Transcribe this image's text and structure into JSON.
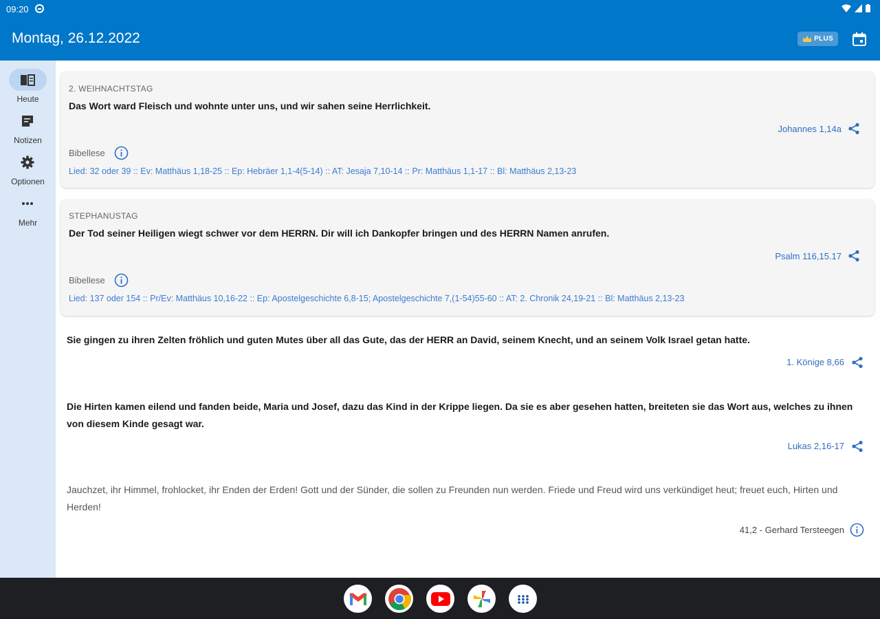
{
  "status": {
    "time": "09:20"
  },
  "appbar": {
    "title": "Montag, 26.12.2022",
    "plus_label": "PLUS"
  },
  "sidebar": {
    "items": [
      {
        "label": "Heute",
        "icon": "book-icon",
        "active": true
      },
      {
        "label": "Notizen",
        "icon": "note-icon",
        "active": false
      },
      {
        "label": "Optionen",
        "icon": "gear-icon",
        "active": false
      },
      {
        "label": "Mehr",
        "icon": "more-icon",
        "active": false
      }
    ]
  },
  "cards": [
    {
      "kicker": "2. WEIHNACHTSTAG",
      "verse": "Das Wort ward Fleisch und wohnte unter uns, und wir sahen seine Herrlichkeit.",
      "reference": "Johannes 1,14a",
      "bibellese_label": "Bibellese",
      "readings": "Lied: 32 oder 39 :: Ev: Matthäus 1,18-25 :: Ep: Hebräer 1,1-4(5-14) :: AT: Jesaja 7,10-14 :: Pr: Matthäus 1,1-17 :: Bl: Matthäus 2,13-23"
    },
    {
      "kicker": "STEPHANUSTAG",
      "verse": "Der Tod seiner Heiligen wiegt schwer vor dem HERRN. Dir will ich Dankopfer bringen und des HERRN Namen anrufen.",
      "reference": "Psalm 116,15.17",
      "bibellese_label": "Bibellese",
      "readings": "Lied: 137 oder 154 :: Pr/Ev: Matthäus 10,16-22 :: Ep: Apostelgeschichte 6,8-15; Apostelgeschichte 7,(1-54)55-60 :: AT: 2. Chronik 24,19-21 :: Bl: Matthäus 2,13-23"
    }
  ],
  "losung": {
    "text": "Sie gingen zu ihren Zelten fröhlich und guten Mutes über all das Gute, das der HERR an David, seinem Knecht, und an seinem Volk Israel getan hatte.",
    "reference": "1. Könige 8,66"
  },
  "lehrtext": {
    "text": "Die Hirten kamen eilend und fanden beide, Maria und Josef, dazu das Kind in der Krippe liegen. Da sie es aber gesehen hatten, breiteten sie das Wort aus, welches zu ihnen von diesem Kinde gesagt war.",
    "reference": "Lukas 2,16-17"
  },
  "hymn": {
    "text": "Jauchzet, ihr Himmel, frohlocket, ihr Enden der Erden! Gott und der Sünder, die sollen zu Freunden nun werden. Friede und Freud wird uns verkündiget heut; freuet euch, Hirten und Herden!",
    "reference": "41,2 - Gerhard Tersteegen"
  },
  "dock": {
    "apps": [
      "gmail-icon",
      "chrome-icon",
      "youtube-icon",
      "photos-icon",
      "app-drawer-icon"
    ]
  },
  "colors": {
    "primary": "#0077c8",
    "link": "#2f6fc0",
    "sidebar": "#dbe8f7"
  }
}
